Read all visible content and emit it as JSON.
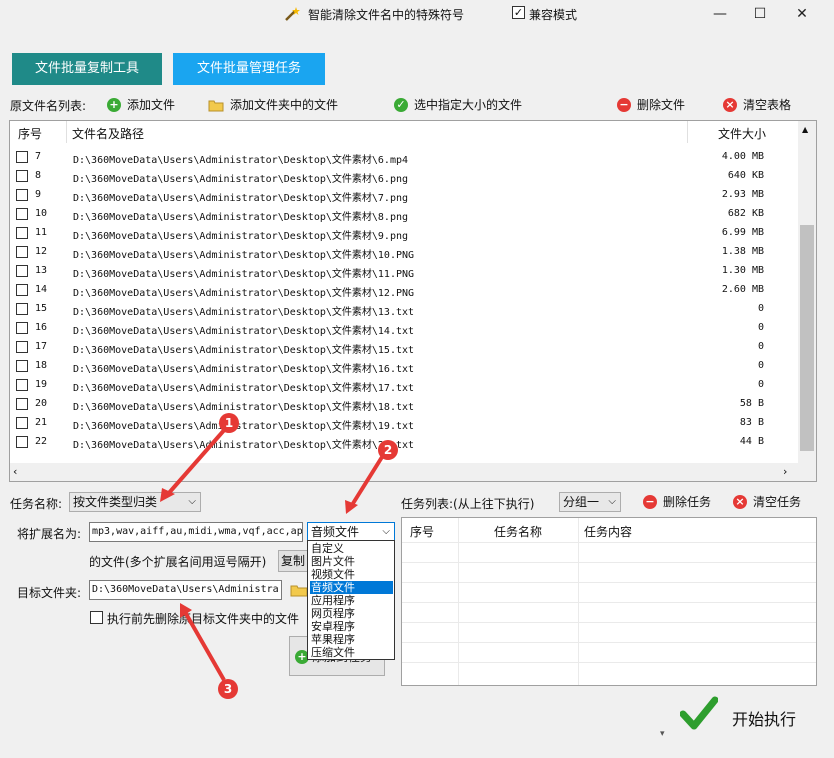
{
  "window": {
    "title": "智能清除文件名中的特殊符号",
    "compat_label": "兼容模式",
    "compat_checked": true,
    "minimize": "—",
    "maximize": "☐",
    "close": "✕"
  },
  "tabs": [
    {
      "label": "文件批量复制工具"
    },
    {
      "label": "文件批量管理任务"
    }
  ],
  "toolbar": {
    "list_label": "原文件名列表:",
    "add_file": "添加文件",
    "add_folder": "添加文件夹中的文件",
    "select_size": "选中指定大小的文件",
    "delete_file": "删除文件",
    "clear_table": "清空表格"
  },
  "file_table": {
    "headers": {
      "no": "序号",
      "path": "文件名及路径",
      "size": "文件大小"
    },
    "rows": [
      {
        "no": "7",
        "path": "D:\\360MoveData\\Users\\Administrator\\Desktop\\文件素材\\6.mp4",
        "size": "4.00 MB"
      },
      {
        "no": "8",
        "path": "D:\\360MoveData\\Users\\Administrator\\Desktop\\文件素材\\6.png",
        "size": "640 KB"
      },
      {
        "no": "9",
        "path": "D:\\360MoveData\\Users\\Administrator\\Desktop\\文件素材\\7.png",
        "size": "2.93 MB"
      },
      {
        "no": "10",
        "path": "D:\\360MoveData\\Users\\Administrator\\Desktop\\文件素材\\8.png",
        "size": "682 KB"
      },
      {
        "no": "11",
        "path": "D:\\360MoveData\\Users\\Administrator\\Desktop\\文件素材\\9.png",
        "size": "6.99 MB"
      },
      {
        "no": "12",
        "path": "D:\\360MoveData\\Users\\Administrator\\Desktop\\文件素材\\10.PNG",
        "size": "1.38 MB"
      },
      {
        "no": "13",
        "path": "D:\\360MoveData\\Users\\Administrator\\Desktop\\文件素材\\11.PNG",
        "size": "1.30 MB"
      },
      {
        "no": "14",
        "path": "D:\\360MoveData\\Users\\Administrator\\Desktop\\文件素材\\12.PNG",
        "size": "2.60 MB"
      },
      {
        "no": "15",
        "path": "D:\\360MoveData\\Users\\Administrator\\Desktop\\文件素材\\13.txt",
        "size": "0"
      },
      {
        "no": "16",
        "path": "D:\\360MoveData\\Users\\Administrator\\Desktop\\文件素材\\14.txt",
        "size": "0"
      },
      {
        "no": "17",
        "path": "D:\\360MoveData\\Users\\Administrator\\Desktop\\文件素材\\15.txt",
        "size": "0"
      },
      {
        "no": "18",
        "path": "D:\\360MoveData\\Users\\Administrator\\Desktop\\文件素材\\16.txt",
        "size": "0"
      },
      {
        "no": "19",
        "path": "D:\\360MoveData\\Users\\Administrator\\Desktop\\文件素材\\17.txt",
        "size": "0"
      },
      {
        "no": "20",
        "path": "D:\\360MoveData\\Users\\Administrator\\Desktop\\文件素材\\18.txt",
        "size": "58 B"
      },
      {
        "no": "21",
        "path": "D:\\360MoveData\\Users\\Administrator\\Desktop\\文件素材\\19.txt",
        "size": "83 B"
      },
      {
        "no": "22",
        "path": "D:\\360MoveData\\Users\\Administrator\\Desktop\\文件素材\\20.txt",
        "size": "44 B"
      }
    ]
  },
  "task_config": {
    "task_name_label": "任务名称:",
    "task_name_value": "按文件类型归类",
    "ext_label": "将扩展名为:",
    "ext_value": "mp3,wav,aiff,au,midi,wma,vqf,acc,ap",
    "type_value": "音频文件",
    "ext_hint": "的文件(多个扩展名间用逗号隔开)",
    "copy_button": "复制",
    "target_label": "目标文件夹:",
    "target_value": "D:\\360MoveData\\Users\\Administra",
    "delete_before_label": "执行前先删除原目标文件夹中的文件",
    "add_task_partial": "添加到任务"
  },
  "type_dropdown": {
    "options": [
      "自定义",
      "图片文件",
      "视频文件",
      "音频文件",
      "应用程序",
      "网页程序",
      "安卓程序",
      "苹果程序",
      "压缩文件"
    ],
    "selected": "音频文件"
  },
  "task_list": {
    "label": "任务列表:(从上往下执行)",
    "group_value": "分组一",
    "delete_task": "删除任务",
    "clear_task": "清空任务",
    "headers": {
      "no": "序号",
      "name": "任务名称",
      "content": "任务内容"
    }
  },
  "start": {
    "label": "开始执行"
  },
  "annotations": [
    "1",
    "2",
    "3"
  ],
  "colors": {
    "tab_copy": "#1f8a88",
    "tab_manage": "#1aa5f0",
    "selection": "#0078d7",
    "badge": "#e53935"
  }
}
